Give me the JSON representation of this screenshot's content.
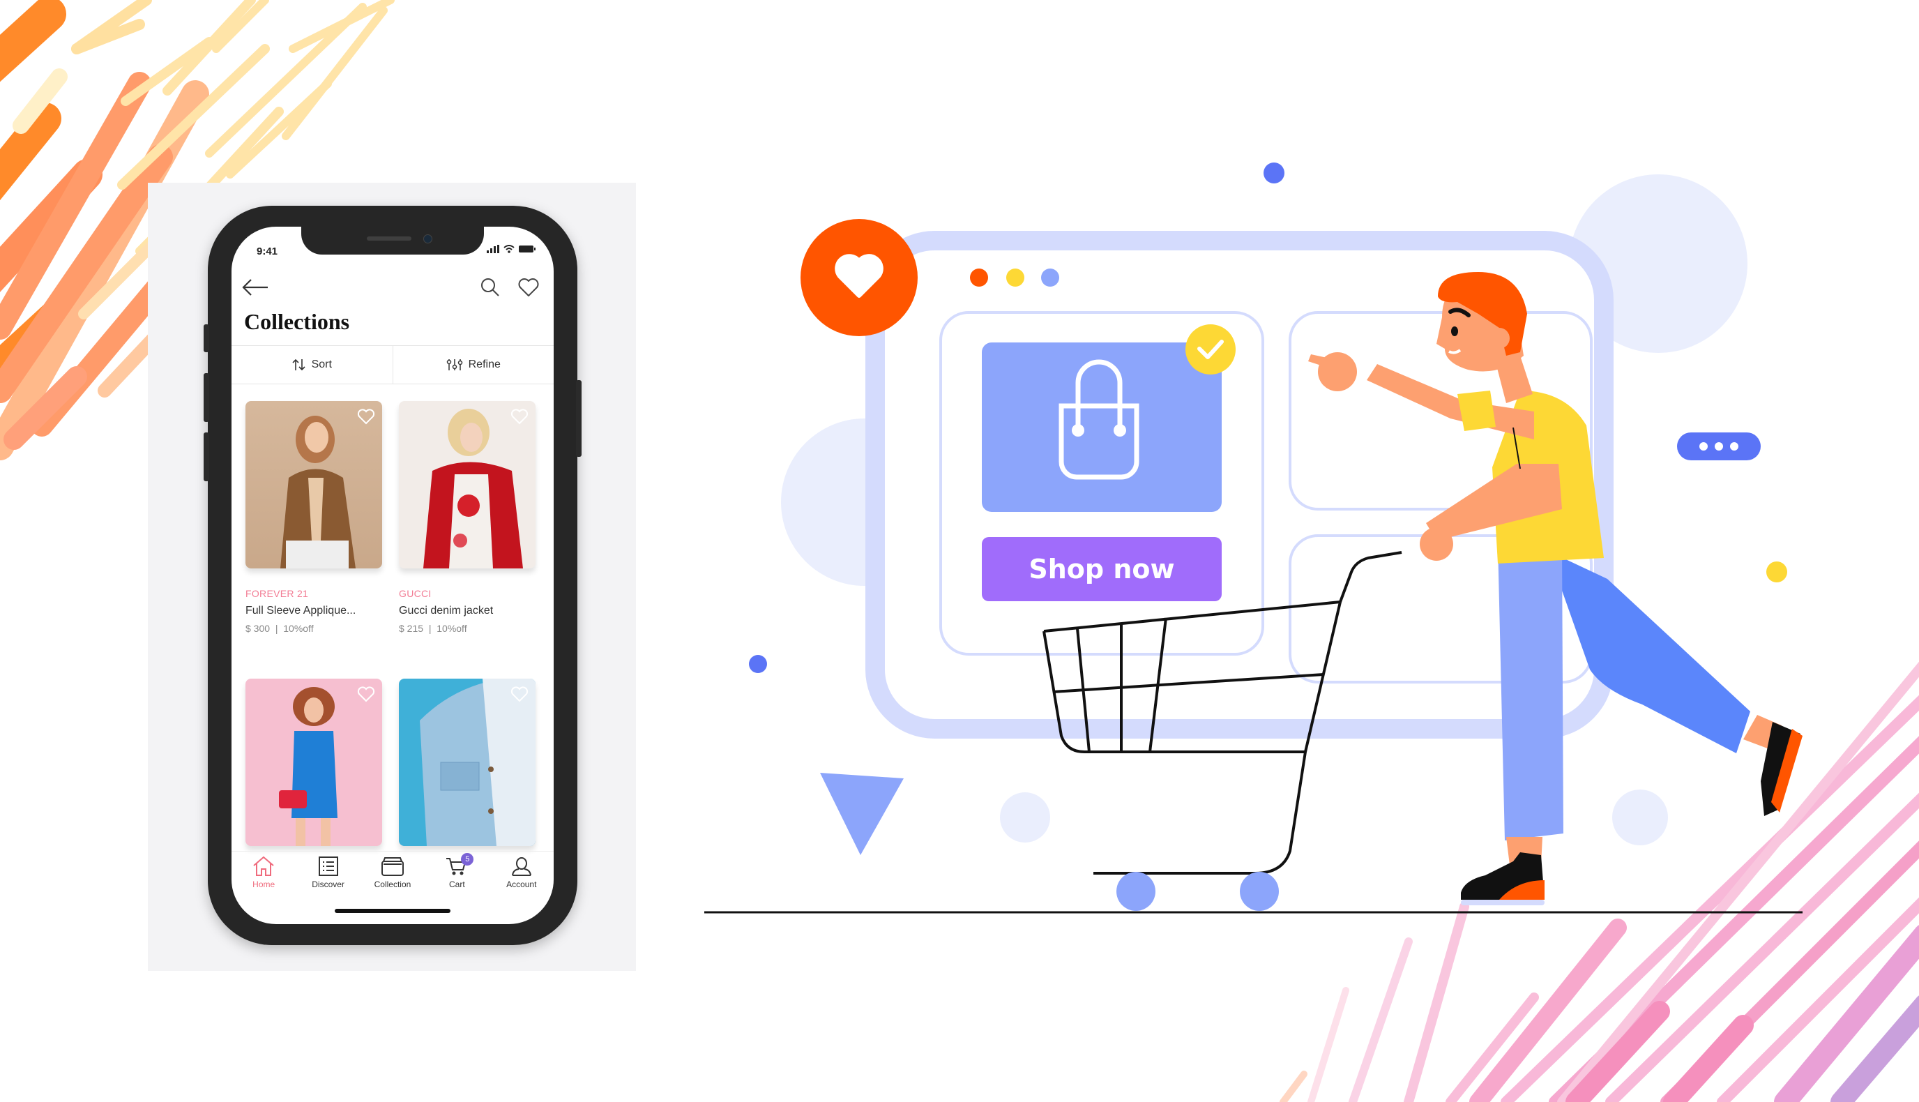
{
  "phone": {
    "status_bar": {
      "time": "9:41"
    },
    "header": {
      "back_icon": "arrow-left-icon",
      "search_icon": "search-icon",
      "wishlist_icon": "heart-outline-icon"
    },
    "title": "Collections",
    "toolbar": {
      "sort_label": "Sort",
      "refine_label": "Refine"
    },
    "products": [
      {
        "brand": "FOREVER 21",
        "name": "Full Sleeve Applique...",
        "price": "$ 300",
        "discount": "10%off",
        "image": "woman-brown-jacket-photo"
      },
      {
        "brand": "GUCCI",
        "name": "Gucci denim jacket",
        "price": "$ 215",
        "discount": "10%off",
        "image": "woman-red-jacket-photo"
      },
      {
        "image": "woman-blue-dress-photo"
      },
      {
        "image": "denim-jacket-photo"
      }
    ],
    "price_separator": "|",
    "tabs": [
      {
        "label": "Home",
        "icon": "home-icon",
        "active": true
      },
      {
        "label": "Discover",
        "icon": "list-icon"
      },
      {
        "label": "Collection",
        "icon": "box-icon"
      },
      {
        "label": "Cart",
        "icon": "cart-icon",
        "badge": "5"
      },
      {
        "label": "Account",
        "icon": "user-icon"
      }
    ]
  },
  "illustration": {
    "shop_button_label": "Shop now",
    "window_dots": [
      "#ff5500",
      "#fdd835",
      "#8ca5fb"
    ],
    "colors": {
      "accent_orange": "#ff5500",
      "product_card": "#8ca5fb",
      "shop_button": "#a06cfb",
      "check_badge": "#fdd835",
      "window_frame": "#d4dbfd",
      "chat_bubble": "#5b74f6",
      "shirt": "#fdd835",
      "pants_light": "#8ca5fb",
      "pants_dark": "#5b86fb",
      "skin": "#fda070"
    }
  }
}
